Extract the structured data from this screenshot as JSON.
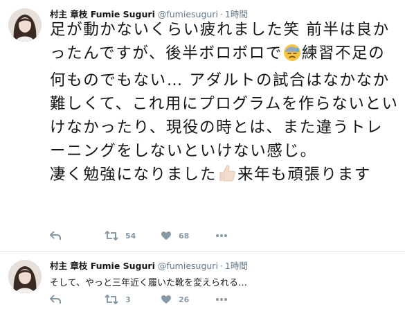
{
  "tweets": [
    {
      "author": "村主 章枝 Fumie Suguri",
      "handle": "@fumiesuguri",
      "separator": "·",
      "time": "1時間",
      "text_paragraphs": [
        "足が動かないくらい疲れました笑 前半は良かったんですが、後半ボロボロで",
        "練習不足の何ものでもない… アダルトの試合はなかなか難しくて、これ用にプログラムを作らないといけなかったり、現役の時とは、また違うトレーニングをしないといけない感じ。",
        "凄く勉強になりました",
        "来年も頑張ります"
      ],
      "emojis": [
        "sweat-face-emoji",
        "thumbs-up-emoji"
      ],
      "retweets": "54",
      "likes": "68"
    },
    {
      "author": "村主 章枝 Fumie Suguri",
      "handle": "@fumiesuguri",
      "separator": "·",
      "time": "1時間",
      "text": "そして、やっと三年近く履いた靴を変えられる…",
      "retweets": "3",
      "likes": "26"
    }
  ],
  "colors": {
    "text": "#14171a",
    "secondary": "#657786",
    "icon": "#8899a6",
    "divider": "#e1e8ed"
  },
  "icons": [
    "reply-icon",
    "retweet-icon",
    "like-icon",
    "more-icon"
  ]
}
